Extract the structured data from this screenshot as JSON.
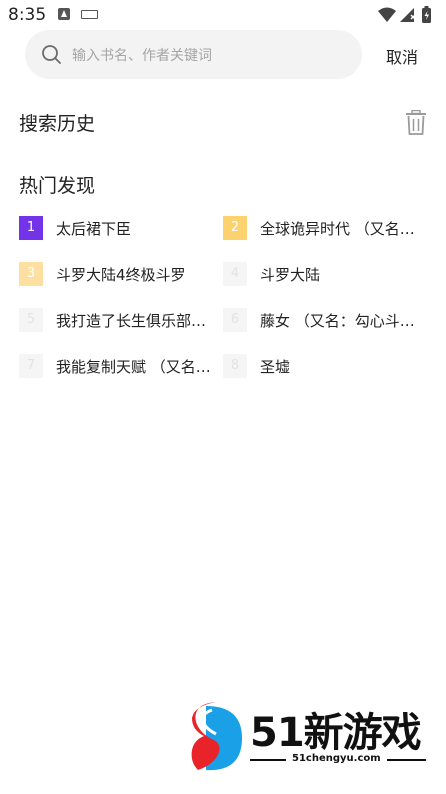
{
  "status_bar": {
    "time": "8:35",
    "icons": [
      "app-store-icon",
      "keyboard-icon",
      "wifi-icon",
      "signal-icon",
      "battery-icon"
    ]
  },
  "search": {
    "placeholder": "输入书名、作者关键词",
    "cancel_label": "取消"
  },
  "history": {
    "title": "搜索历史"
  },
  "hot": {
    "title": "热门发现",
    "items": [
      {
        "rank": "1",
        "title": "太后裙下臣"
      },
      {
        "rank": "2",
        "title": "全球诡异时代 （又名…"
      },
      {
        "rank": "3",
        "title": "斗罗大陆4终极斗罗"
      },
      {
        "rank": "4",
        "title": "斗罗大陆"
      },
      {
        "rank": "5",
        "title": "我打造了长生俱乐部…"
      },
      {
        "rank": "6",
        "title": "藤女 （又名：勾心斗…"
      },
      {
        "rank": "7",
        "title": "我能复制天赋 （又名…"
      },
      {
        "rank": "8",
        "title": "圣墟"
      }
    ]
  },
  "watermark": {
    "brand": "51新游戏",
    "url": "51chengyu.com"
  },
  "colors": {
    "rank1": "#7334e9",
    "rank2": "#fcd26f",
    "rank3": "#fde0a1",
    "rank_other": "#f5f5f5"
  }
}
